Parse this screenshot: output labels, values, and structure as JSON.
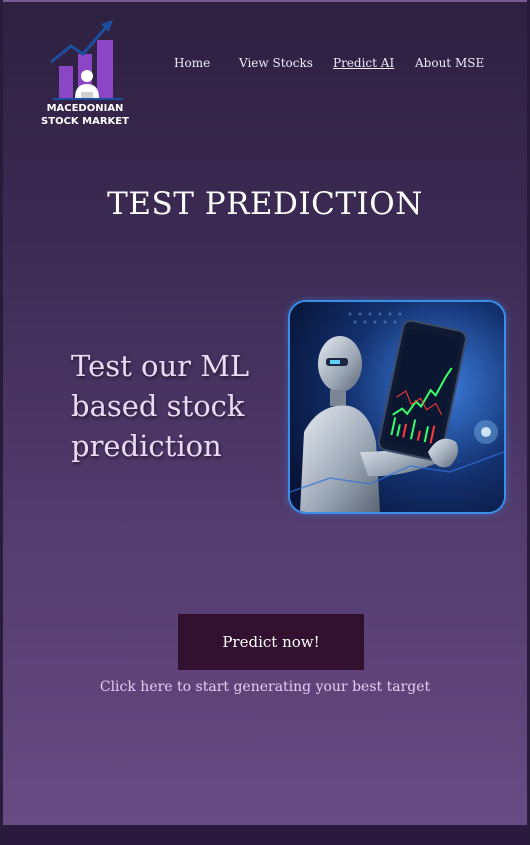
{
  "brand": {
    "name_line1": "MACEDONIAN",
    "name_line2": "STOCK MARKET",
    "logo_icon": "bar-chart-trend-icon",
    "accent": "#8a46c4"
  },
  "nav": {
    "items": [
      {
        "label": "Home"
      },
      {
        "label": "View Stocks"
      },
      {
        "label": "Predict AI",
        "active": true
      },
      {
        "label": "About MSE"
      }
    ]
  },
  "main": {
    "title": "TEST PREDICTION",
    "tagline": "Test our ML based stock prediction",
    "image_description_icon": "robot-holding-phone-chart-icon",
    "cta_label": "Predict now!",
    "cta_hint": "Click here to start generating your best target"
  },
  "colors": {
    "bg_top": "#2d2040",
    "bg_bottom": "#694c84",
    "button": "#32102f",
    "frame_border": "#3a8ee8"
  }
}
